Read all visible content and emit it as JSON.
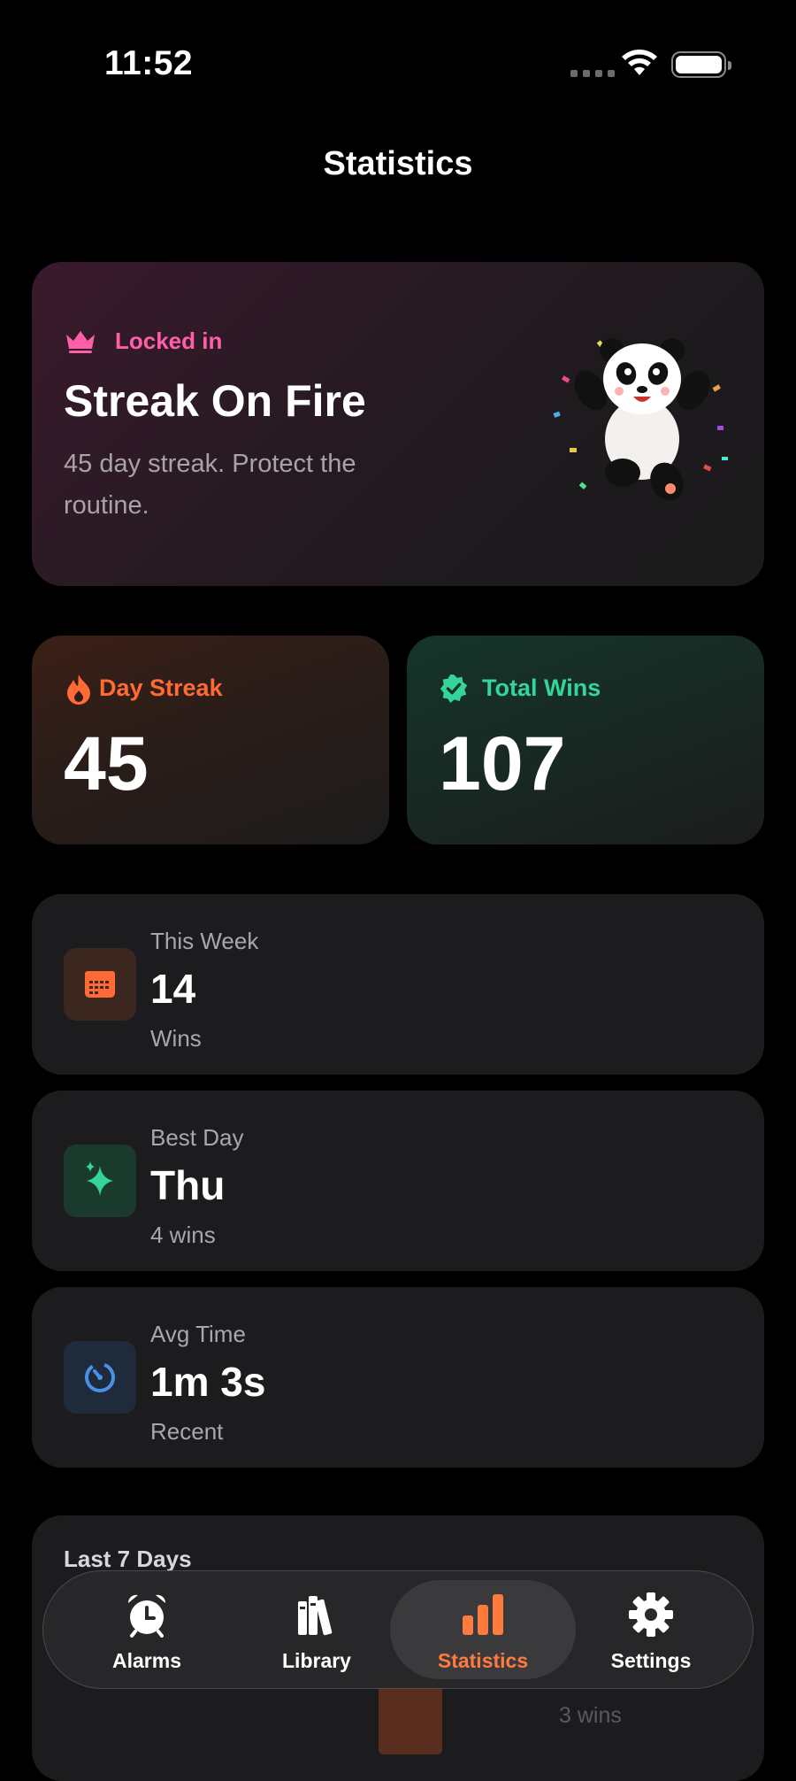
{
  "status_bar": {
    "time": "11:52"
  },
  "header": {
    "title": "Statistics"
  },
  "hero": {
    "tag": "Locked in",
    "title": "Streak On Fire",
    "subtitle": "45 day streak. Protect the routine.",
    "tag_icon": "crown-icon",
    "image": "celebrating-panda"
  },
  "stats": {
    "streak": {
      "label": "Day Streak",
      "value": "45",
      "icon": "flame-icon",
      "color": "#ff6a35"
    },
    "wins": {
      "label": "Total Wins",
      "value": "107",
      "icon": "verified-badge-icon",
      "color": "#34d49a"
    }
  },
  "rows": [
    {
      "sub": "This Week",
      "value": "14",
      "caption": "Wins",
      "icon": "calendar-icon",
      "color": "#ff6a35"
    },
    {
      "sub": "Best Day",
      "value": "Thu",
      "caption": "4 wins",
      "icon": "sparkle-icon",
      "color": "#34d49a"
    },
    {
      "sub": "Avg Time",
      "value": "1m 3s",
      "caption": "Recent",
      "icon": "timer-icon",
      "color": "#4a8fe8"
    }
  ],
  "chart": {
    "title": "Last 7 Days",
    "visible_label": "3 wins"
  },
  "tabbar": {
    "tabs": [
      {
        "label": "Alarms",
        "icon": "alarm-clock-icon"
      },
      {
        "label": "Library",
        "icon": "books-icon"
      },
      {
        "label": "Statistics",
        "icon": "bar-chart-icon"
      },
      {
        "label": "Settings",
        "icon": "gear-icon"
      }
    ],
    "active_index": 2,
    "accent": "#ff7a3d"
  }
}
